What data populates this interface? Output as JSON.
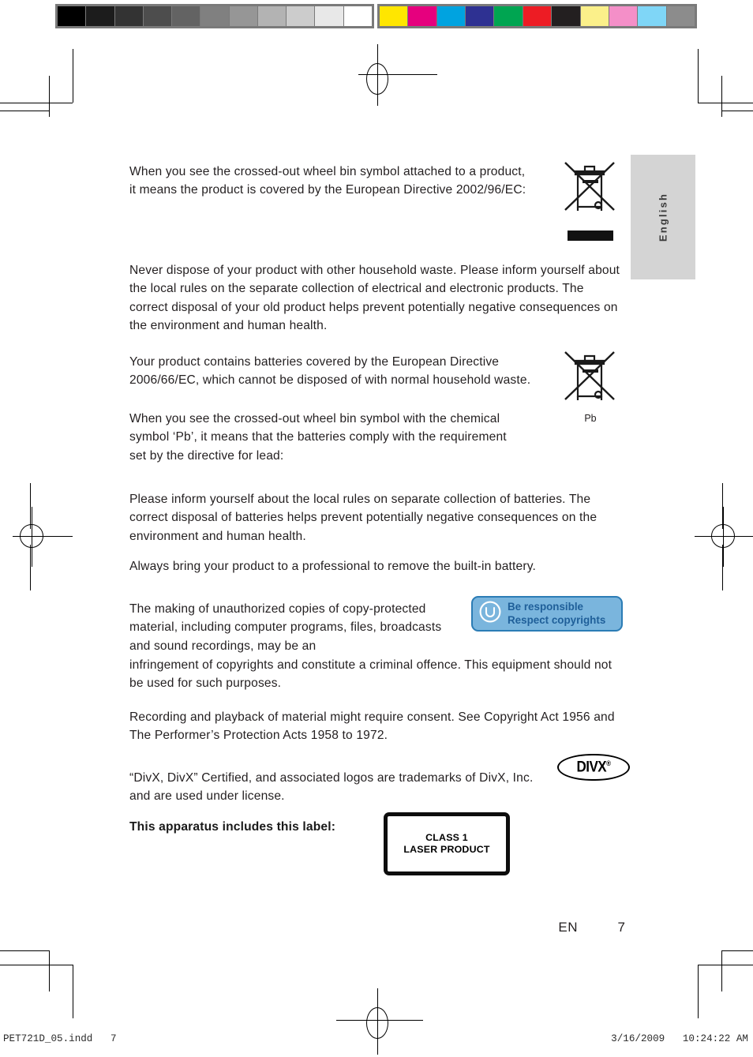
{
  "proof": {
    "gray_bar": [
      "#000000",
      "#1c1c1c",
      "#333333",
      "#4d4d4d",
      "#636363",
      "#808080",
      "#969696",
      "#b3b3b3",
      "#cccccc",
      "#e8e8e8",
      "#ffffff"
    ],
    "color_bar": [
      "#ffe600",
      "#e6007e",
      "#00a3e0",
      "#2e3192",
      "#00a551",
      "#ed1c24",
      "#231f20",
      "#fbf08a",
      "#f48fc8",
      "#7fd6f7",
      "#8c8c8c"
    ],
    "footer_left": "PET721D_05.indd   7",
    "footer_right": "3/16/2009   10:24:22 AM"
  },
  "side_tab": {
    "label": "English"
  },
  "content": {
    "p1": "When you see the crossed-out wheel bin symbol attached to a product, it means the product is covered by the European Directive 2002/96/EC:",
    "p2": "Never dispose of your product with other household waste. Please inform yourself about the local rules on the separate collection of electrical and electronic products. The correct disposal of your old product helps prevent potentially negative consequences on the environment and human health.",
    "p3": "Your product contains batteries covered by the European Directive 2006/66/EC, which cannot be disposed of with normal household waste.",
    "p4": "When you see the crossed-out wheel bin symbol with the chemical symbol ‘Pb’, it means that the batteries comply with the requirement set by the directive for lead:",
    "p5": "Please inform yourself about the local rules on separate collection of batteries. The correct disposal of batteries helps prevent potentially negative consequences on the environment and human health.",
    "p6": "Always bring your product to a professional to remove the built-in battery.",
    "p7a": "The making of unauthorized copies of copy-protected material, including computer programs, files, broadcasts and sound recordings, may be an",
    "p7b": "infringement of copyrights and constitute a criminal offence. This equipment should not be used for such purposes.",
    "p8": "Recording and playback of material might require consent. See Copyright Act 1956 and The Performer’s Protection Acts 1958 to 1972.",
    "p9": "“DivX, DivX” Certified, and associated logos are trademarks of DivX, Inc. and are used under license.",
    "p10": "This apparatus includes this label:"
  },
  "symbols": {
    "bin_lead_caption": "Pb"
  },
  "copyright_badge": {
    "line1": "Be responsible",
    "line2": "Respect copyrights",
    "fill": "#7ab5dd",
    "border": "#2b7cb5",
    "text_color": "#1f5f99"
  },
  "divx": {
    "wordmark": "DIVX",
    "registered": "®"
  },
  "laser_label": {
    "line1": "CLASS 1",
    "line2": "LASER PRODUCT"
  },
  "page_footer": {
    "language": "EN",
    "page_number": "7"
  }
}
